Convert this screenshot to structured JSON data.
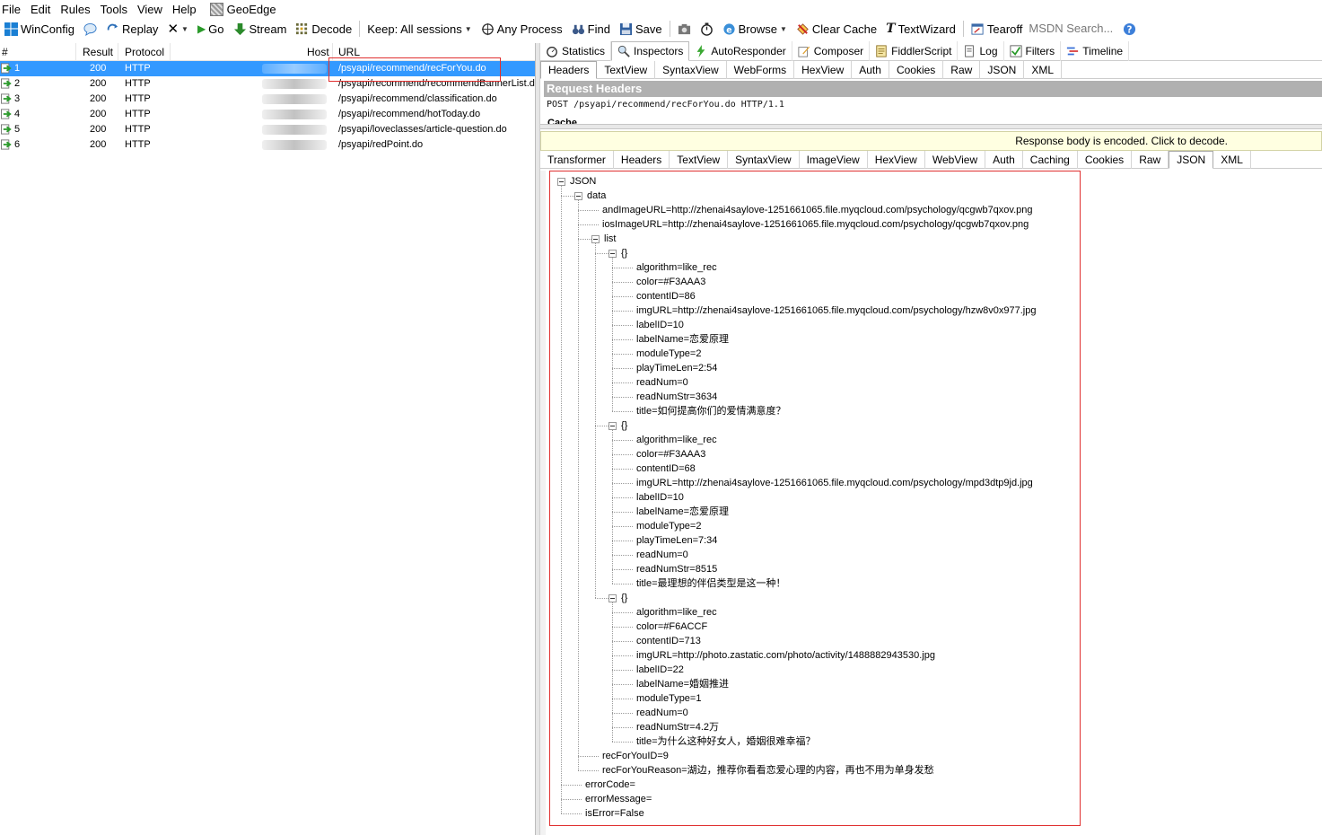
{
  "menu": [
    "File",
    "Edit",
    "Rules",
    "Tools",
    "View",
    "Help",
    "GeoEdge"
  ],
  "toolbar": {
    "winconfig": "WinConfig",
    "replay": "Replay",
    "go": "Go",
    "stream": "Stream",
    "decode": "Decode",
    "keep": "Keep: All sessions",
    "any_process": "Any Process",
    "find": "Find",
    "save": "Save",
    "browse": "Browse",
    "clear_cache": "Clear Cache",
    "textwizard": "TextWizard",
    "tearoff": "Tearoff",
    "msdn_placeholder": "MSDN Search..."
  },
  "sessions": {
    "headers": {
      "num": "#",
      "result": "Result",
      "protocol": "Protocol",
      "host": "Host",
      "url": "URL"
    },
    "rows": [
      {
        "num": "1",
        "result": "200",
        "protocol": "HTTP",
        "url": "/psyapi/recommend/recForYou.do",
        "selected": true
      },
      {
        "num": "2",
        "result": "200",
        "protocol": "HTTP",
        "url": "/psyapi/recommend/recommendBannerList.do"
      },
      {
        "num": "3",
        "result": "200",
        "protocol": "HTTP",
        "url": "/psyapi/recommend/classification.do"
      },
      {
        "num": "4",
        "result": "200",
        "protocol": "HTTP",
        "url": "/psyapi/recommend/hotToday.do"
      },
      {
        "num": "5",
        "result": "200",
        "protocol": "HTTP",
        "url": "/psyapi/loveclasses/article-question.do"
      },
      {
        "num": "6",
        "result": "200",
        "protocol": "HTTP",
        "url": "/psyapi/redPoint.do"
      }
    ]
  },
  "main_tabs": [
    "Statistics",
    "Inspectors",
    "AutoResponder",
    "Composer",
    "FiddlerScript",
    "Log",
    "Filters",
    "Timeline"
  ],
  "request_tabs": [
    "Headers",
    "TextView",
    "SyntaxView",
    "WebForms",
    "HexView",
    "Auth",
    "Cookies",
    "Raw",
    "JSON",
    "XML"
  ],
  "request": {
    "title": "Request Headers",
    "line": "POST /psyapi/recommend/recForYou.do HTTP/1.1",
    "cache_label": "Cache"
  },
  "encoded_notice": "Response body is encoded. Click to decode.",
  "response_tabs": [
    "Transformer",
    "Headers",
    "TextView",
    "SyntaxView",
    "ImageView",
    "HexView",
    "WebView",
    "Auth",
    "Caching",
    "Cookies",
    "Raw",
    "JSON",
    "XML"
  ],
  "tree": {
    "root": "JSON",
    "data": "data",
    "andImageURL": "andImageURL=http://zhenai4saylove-1251661065.file.myqcloud.com/psychology/qcgwb7qxov.png",
    "iosImageURL": "iosImageURL=http://zhenai4saylove-1251661065.file.myqcloud.com/psychology/qcgwb7qxov.png",
    "list": "list",
    "items": [
      {
        "label": "{}",
        "fields": [
          "algorithm=like_rec",
          "color=#F3AAA3",
          "contentID=86",
          "imgURL=http://zhenai4saylove-1251661065.file.myqcloud.com/psychology/hzw8v0x977.jpg",
          "labelID=10",
          "labelName=恋爱原理",
          "moduleType=2",
          "playTimeLen=2:54",
          "readNum=0",
          "readNumStr=3634",
          "title=如何提高你们的爱情满意度？"
        ]
      },
      {
        "label": "{}",
        "fields": [
          "algorithm=like_rec",
          "color=#F3AAA3",
          "contentID=68",
          "imgURL=http://zhenai4saylove-1251661065.file.myqcloud.com/psychology/mpd3dtp9jd.jpg",
          "labelID=10",
          "labelName=恋爱原理",
          "moduleType=2",
          "playTimeLen=7:34",
          "readNum=0",
          "readNumStr=8515",
          "title=最理想的伴侣类型是这一种！"
        ]
      },
      {
        "label": "{}",
        "fields": [
          "algorithm=like_rec",
          "color=#F6ACCF",
          "contentID=713",
          "imgURL=http://photo.zastatic.com/photo/activity/1488882943530.jpg",
          "labelID=22",
          "labelName=婚姻推进",
          "moduleType=1",
          "readNum=0",
          "readNumStr=4.2万",
          "title=为什么这种好女人，婚姻很难幸福？"
        ]
      }
    ],
    "recForYouID": "recForYouID=9",
    "recForYouReason": "recForYouReason=湖边，推荐你看看恋爱心理的内容，再也不用为单身发愁",
    "errorCode": "errorCode=",
    "errorMessage": "errorMessage=",
    "isError": "isError=False"
  },
  "colors": {
    "selection": "#3399ff",
    "highlight_box": "#e03030",
    "notice_bg": "#ffffe1"
  }
}
